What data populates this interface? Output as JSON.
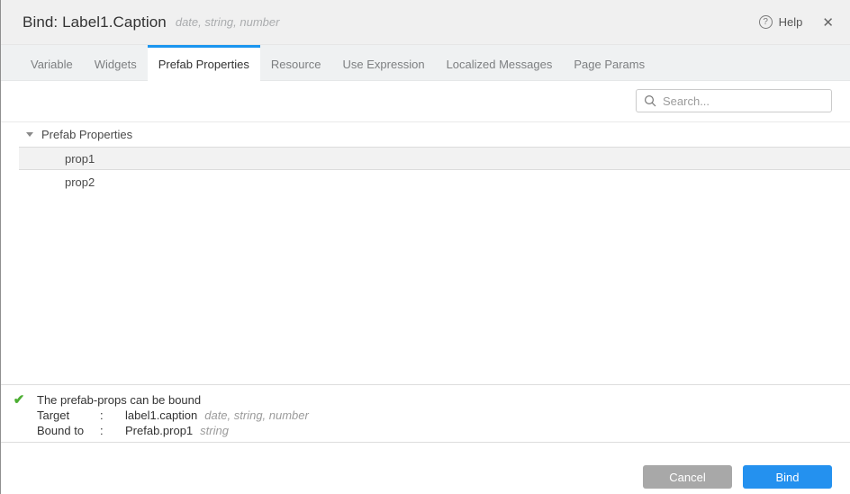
{
  "dialog": {
    "title": "Bind: Label1.Caption",
    "title_hint": "date, string, number",
    "help_label": "Help",
    "help_icon_glyph": "?",
    "close_icon_glyph": "✕"
  },
  "tabs": [
    {
      "label": "Variable",
      "active": false
    },
    {
      "label": "Widgets",
      "active": false
    },
    {
      "label": "Prefab Properties",
      "active": true
    },
    {
      "label": "Resource",
      "active": false
    },
    {
      "label": "Use Expression",
      "active": false
    },
    {
      "label": "Localized Messages",
      "active": false
    },
    {
      "label": "Page Params",
      "active": false
    }
  ],
  "search": {
    "placeholder": "Search..."
  },
  "tree": {
    "group_label": "Prefab Properties",
    "items": [
      {
        "label": "prop1",
        "selected": true
      },
      {
        "label": "prop2",
        "selected": false
      }
    ]
  },
  "status": {
    "check_glyph": "✔",
    "message": "The prefab-props can be bound",
    "rows": [
      {
        "label": "Target",
        "separator": ":",
        "value": "label1.caption",
        "hint": "date, string, number"
      },
      {
        "label": "Bound to",
        "separator": ":",
        "value": "Prefab.prop1",
        "hint": "string"
      }
    ]
  },
  "footer": {
    "cancel_label": "Cancel",
    "bind_label": "Bind"
  },
  "colors": {
    "accent_blue": "#2491ef",
    "tab_indicator_blue": "#1b95ef",
    "success_green": "#4cae32",
    "cancel_gray": "#a8a8a8",
    "header_bg": "#f0f0f0",
    "tabbar_bg": "#eff1f2",
    "selected_row_bg": "#f2f2f2"
  }
}
